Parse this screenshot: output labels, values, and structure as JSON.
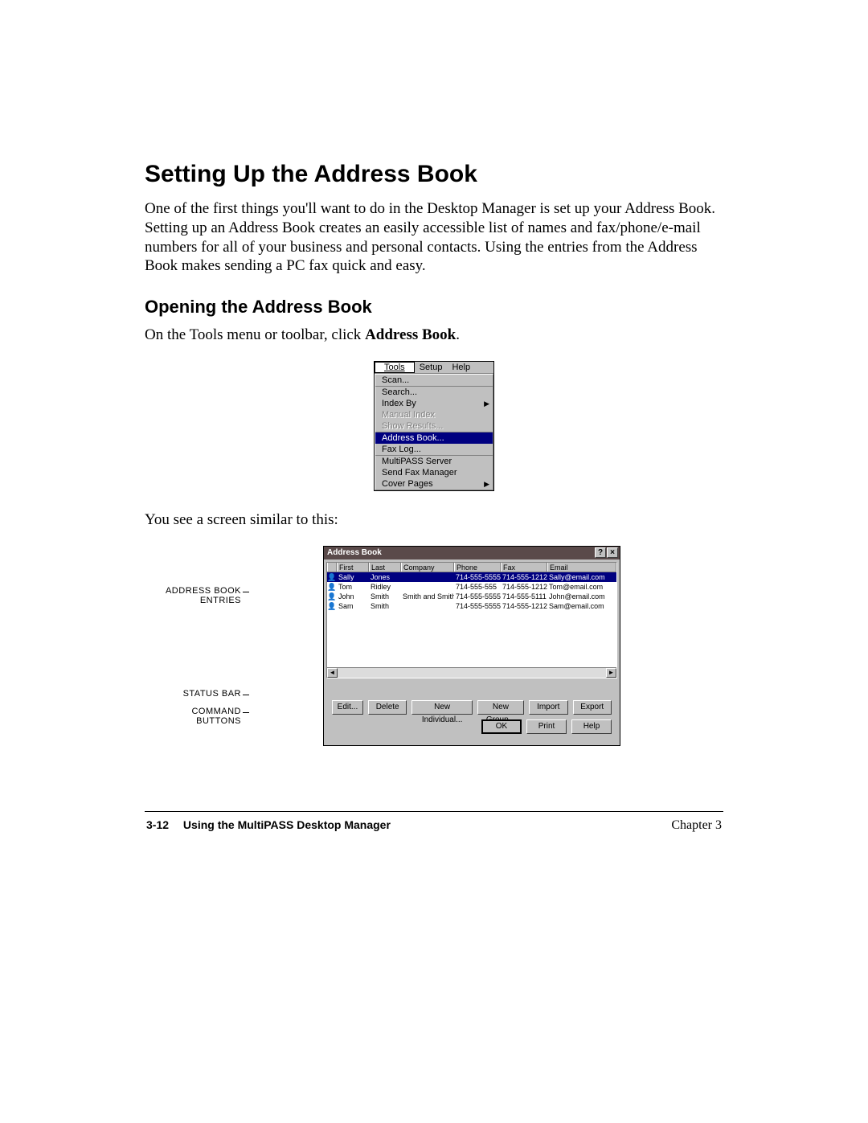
{
  "page": {
    "heading": "Setting Up the Address Book",
    "intro": "One of the first things you'll want to do in the Desktop Manager is set up your Address Book. Setting up an Address Book creates an easily accessible list of names and fax/phone/e-mail numbers for all of your business and personal contacts. Using the entries from the Address Book makes sending a PC fax quick and easy.",
    "subheading": "Opening the Address Book",
    "instruction_prefix": "On the Tools menu or toolbar, click ",
    "instruction_bold": "Address Book",
    "instruction_suffix": ".",
    "screen_lead": "You see a screen similar to this:"
  },
  "tools_menu": {
    "menubar": {
      "tools": "Tools",
      "setup": "Setup",
      "help": "Help"
    },
    "items": {
      "scan": "Scan...",
      "search": "Search...",
      "index_by": "Index By",
      "manual_index": "Manual Index",
      "show_results": "Show Results...",
      "address_book": "Address Book...",
      "fax_log": "Fax Log...",
      "multipass_server": "MultiPASS Server",
      "send_fax_manager": "Send Fax Manager",
      "cover_pages": "Cover Pages"
    }
  },
  "address_book": {
    "title": "Address Book",
    "help_btn": "?",
    "close_btn": "×",
    "columns": {
      "first": "First",
      "last": "Last",
      "company": "Company",
      "phone": "Phone",
      "fax": "Fax",
      "email": "Email"
    },
    "rows": [
      {
        "first": "Sally",
        "last": "Jones",
        "company": "",
        "phone": "714-555-5555",
        "fax": "714-555-1212",
        "email": "Sally@email.com",
        "selected": true
      },
      {
        "first": "Tom",
        "last": "Ridley",
        "company": "",
        "phone": "714-555-555",
        "fax": "714-555-1212",
        "email": "Tom@email.com",
        "selected": false
      },
      {
        "first": "John",
        "last": "Smith",
        "company": "Smith and Smith",
        "phone": "714-555-5555",
        "fax": "714-555-5111",
        "email": "John@email.com",
        "selected": false
      },
      {
        "first": "Sam",
        "last": "Smith",
        "company": "",
        "phone": "714-555-5555",
        "fax": "714-555-1212",
        "email": "Sam@email.com",
        "selected": false
      }
    ],
    "buttons": {
      "edit": "Edit...",
      "delete": "Delete",
      "new_individual": "New Individual...",
      "new_group": "New Group...",
      "import": "Import",
      "export": "Export",
      "ok": "OK",
      "print": "Print",
      "help": "Help"
    },
    "scroll": {
      "left": "◄",
      "right": "►"
    }
  },
  "callouts": {
    "entries": "ADDRESS BOOK ENTRIES",
    "status": "STATUS BAR",
    "commands": "COMMAND BUTTONS"
  },
  "footer": {
    "page_num": "3-12",
    "section": "Using the MultiPASS Desktop Manager",
    "chapter": "Chapter 3"
  }
}
